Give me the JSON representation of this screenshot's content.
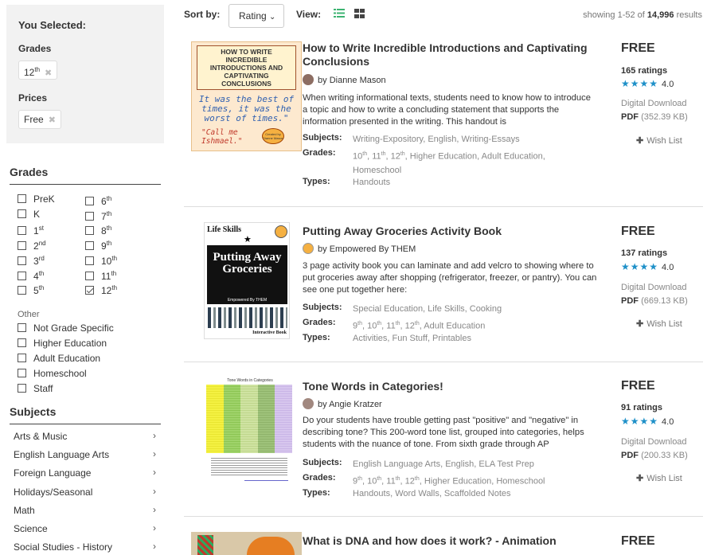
{
  "selected": {
    "heading": "You Selected:",
    "grades_label": "Grades",
    "grade_chip": "12",
    "grade_chip_sup": "th",
    "prices_label": "Prices",
    "price_chip": "Free",
    "remove_glyph": "✖"
  },
  "grades": {
    "heading": "Grades",
    "col1": [
      {
        "base": "PreK",
        "sup": "",
        "checked": false
      },
      {
        "base": "K",
        "sup": "",
        "checked": false
      },
      {
        "base": "1",
        "sup": "st",
        "checked": false
      },
      {
        "base": "2",
        "sup": "nd",
        "checked": false
      },
      {
        "base": "3",
        "sup": "rd",
        "checked": false
      },
      {
        "base": "4",
        "sup": "th",
        "checked": false
      },
      {
        "base": "5",
        "sup": "th",
        "checked": false
      }
    ],
    "col2": [
      {
        "base": "6",
        "sup": "th",
        "checked": false
      },
      {
        "base": "7",
        "sup": "th",
        "checked": false
      },
      {
        "base": "8",
        "sup": "th",
        "checked": false
      },
      {
        "base": "9",
        "sup": "th",
        "checked": false
      },
      {
        "base": "10",
        "sup": "th",
        "checked": false
      },
      {
        "base": "11",
        "sup": "th",
        "checked": false
      },
      {
        "base": "12",
        "sup": "th",
        "checked": true
      }
    ],
    "other_label": "Other",
    "other": [
      "Not Grade Specific",
      "Higher Education",
      "Adult Education",
      "Homeschool",
      "Staff"
    ]
  },
  "subjects": {
    "heading": "Subjects",
    "items": [
      "Arts & Music",
      "English Language Arts",
      "Foreign Language",
      "Holidays/Seasonal",
      "Math",
      "Science",
      "Social Studies - History"
    ],
    "chevron": "›"
  },
  "toolbar": {
    "sort_label": "Sort by:",
    "sort_value": "Rating",
    "sort_caret": "⌄",
    "view_label": "View:",
    "showing_prefix": "showing 1-52 of ",
    "showing_count": "14,996",
    "showing_suffix": " results"
  },
  "labels": {
    "subjects": "Subjects:",
    "grades": "Grades:",
    "types": "Types:",
    "by": "by ",
    "wish": "Wish List",
    "plus": "✚",
    "download": "Digital Download",
    "pdf": "PDF",
    "stars": "★★★★"
  },
  "colors": {
    "accent": "#1e90c8",
    "list_icon": "#3cb371",
    "grid_icon": "#444444"
  },
  "products": [
    {
      "title": "How to Write Incredible Introductions and Captivating Conclusions",
      "author": "Dianne Mason",
      "description": "When writing informational texts, students need to know how to introduce a topic and how to write a concluding statement that supports the information presented in the writing. This handout is",
      "subjects": "Writing-Expository, English, Writing-Essays",
      "grades_html": "10<sup>th</sup>, 11<sup>th</sup>, 12<sup>th</sup>, Higher Education, Adult Education, Homeschool",
      "types": "Handouts",
      "price": "FREE",
      "ratings": "165 ratings",
      "rating_value": "4.0",
      "file_size": "(352.39 KB)",
      "thumb": {
        "head": "HOW TO WRITE INCREDIBLE INTRODUCTIONS AND CAPTIVATING CONCLUSIONS",
        "quote": "It was the best of times, it was the worst of times.\"",
        "call": "\"Call me Ishmael.\"",
        "badge": "Created by Dianne Mason"
      }
    },
    {
      "title": "Putting Away Groceries Activity Book",
      "author": "Empowered By THEM",
      "description": "3 page activity book you can laminate and add velcro to showing where to put groceries away after shopping (refrigerator, freezer, or pantry). You can see one put together here:",
      "subjects": "Special Education, Life Skills, Cooking",
      "grades_html": "9<sup>th</sup>, 10<sup>th</sup>, 11<sup>th</sup>, 12<sup>th</sup>, Adult Education",
      "types": "Activities, Fun Stuff, Printables",
      "price": "FREE",
      "ratings": "137 ratings",
      "rating_value": "4.0",
      "file_size": "(669.13 KB)",
      "thumb": {
        "top": "Life Skills",
        "main": "Putting Away Groceries",
        "by": "Empowered By THEM",
        "foot": "Interactive Book"
      }
    },
    {
      "title": "Tone Words in Categories!",
      "author": "Angie Kratzer",
      "description": "Do your students have trouble getting past \"positive\" and \"negative\" in describing tone? This 200-word tone list, grouped into categories, helps students with the nuance of tone. From sixth grade through AP",
      "subjects": "English Language Arts, English, ELA Test Prep",
      "grades_html": "9<sup>th</sup>, 10<sup>th</sup>, 11<sup>th</sup>, 12<sup>th</sup>, Higher Education, Homeschool",
      "types": "Handouts, Word Walls, Scaffolded Notes",
      "price": "FREE",
      "ratings": "91 ratings",
      "rating_value": "4.0",
      "file_size": "(200.33 KB)",
      "thumb": {
        "head": "Tone Words in Categories"
      }
    },
    {
      "title": "What is DNA and how does it work? - Animation",
      "price": "FREE"
    }
  ]
}
